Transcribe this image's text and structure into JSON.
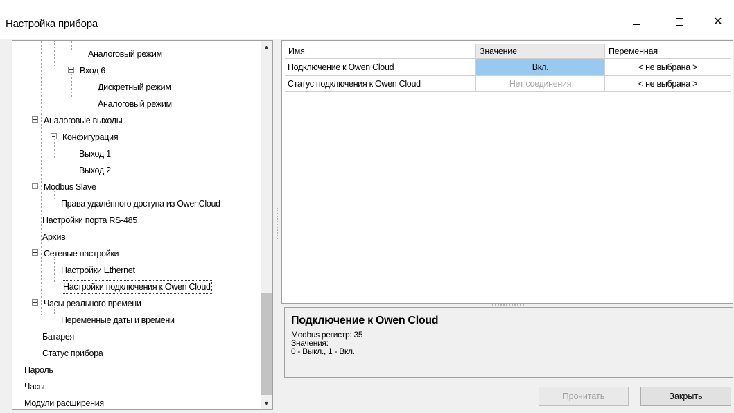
{
  "window": {
    "title": "Настройка прибора",
    "minimize_glyph": "—",
    "maximize_glyph": "☐",
    "close_glyph": "✕"
  },
  "tree": {
    "items": [
      {
        "label": "Аналоговый режим",
        "expanded": null
      },
      {
        "label": "Вход 6",
        "expanded": true
      },
      {
        "label": "Дискретный режим",
        "expanded": null
      },
      {
        "label": "Аналоговый режим",
        "expanded": null
      },
      {
        "label": "Аналоговые выходы",
        "expanded": true
      },
      {
        "label": "Конфигурация",
        "expanded": true
      },
      {
        "label": "Выход 1",
        "expanded": null
      },
      {
        "label": "Выход 2",
        "expanded": null
      },
      {
        "label": "Modbus Slave",
        "expanded": true
      },
      {
        "label": "Права удалённого доступа из OwenCloud",
        "expanded": null
      },
      {
        "label": "Настройки порта RS-485",
        "expanded": null
      },
      {
        "label": "Архив",
        "expanded": null
      },
      {
        "label": "Сетевые настройки",
        "expanded": true
      },
      {
        "label": "Настройки Ethernet",
        "expanded": null
      },
      {
        "label": "Настройки подключения к Owen Cloud",
        "expanded": null,
        "selected": true
      },
      {
        "label": "Часы реального времени",
        "expanded": true
      },
      {
        "label": "Переменные даты и времени",
        "expanded": null
      },
      {
        "label": "Батарея",
        "expanded": null
      },
      {
        "label": "Статус прибора",
        "expanded": null
      },
      {
        "label": "Пароль",
        "expanded": null
      },
      {
        "label": "Часы",
        "expanded": null
      },
      {
        "label": "Модули расширения",
        "expanded": null
      }
    ],
    "scroll_up_glyph": "▲",
    "scroll_down_glyph": "▼"
  },
  "grid": {
    "columns": [
      "Имя",
      "Значение",
      "Переменная"
    ],
    "rows": [
      {
        "name": "Подключение к Owen Cloud",
        "value": "Вкл.",
        "variable": "< не выбрана >"
      },
      {
        "name": "Статус подключения к Owen Cloud",
        "value": "Нет соединения",
        "variable": "< не выбрана >"
      }
    ]
  },
  "description": {
    "title": "Подключение к Owen Cloud",
    "lines": [
      "Modbus регистр: 35",
      "Значения:",
      "0 - Выкл., 1 - Вкл."
    ]
  },
  "buttons": {
    "read": "Прочитать",
    "close": "Закрыть"
  },
  "colors": {
    "selected_cell": "#99c9ef",
    "disabled_text": "#a8a8a8"
  }
}
